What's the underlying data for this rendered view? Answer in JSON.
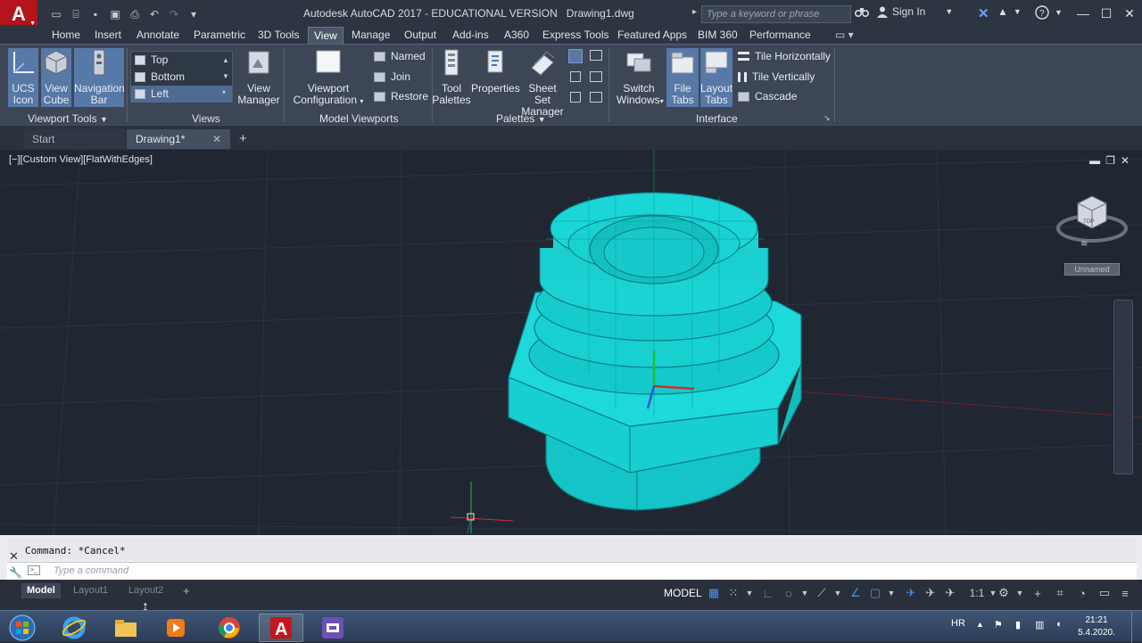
{
  "app": {
    "logo_letter": "A",
    "title": "Autodesk AutoCAD 2017 - EDUCATIONAL VERSION",
    "document": "Drawing1.dwg",
    "search_placeholder": "Type a keyword or phrase",
    "sign_in": "Sign In"
  },
  "ribbon_tabs": [
    "Home",
    "Insert",
    "Annotate",
    "Parametric",
    "3D Tools",
    "View",
    "Manage",
    "Output",
    "Add-ins",
    "A360",
    "Express Tools",
    "Featured Apps",
    "BIM 360",
    "Performance"
  ],
  "active_tab": "View",
  "ribbon": {
    "viewport_tools": {
      "label": "Viewport Tools",
      "ucs_icon": [
        "UCS",
        "Icon"
      ],
      "view_cube": [
        "View",
        "Cube"
      ],
      "navigation_bar": [
        "Navigation",
        "Bar"
      ]
    },
    "views": {
      "label": "Views",
      "items": [
        "Top",
        "Bottom",
        "Left"
      ],
      "selected": "Left",
      "view_manager": [
        "View",
        "Manager"
      ]
    },
    "model_viewports": {
      "label": "Model Viewports",
      "viewport_configuration": [
        "Viewport",
        "Configuration"
      ],
      "named": "Named",
      "join": "Join",
      "restore": "Restore"
    },
    "palettes": {
      "label": "Palettes",
      "tool_palettes": [
        "Tool",
        "Palettes"
      ],
      "properties": "Properties",
      "sheet_set_manager": [
        "Sheet Set",
        "Manager"
      ]
    },
    "interface": {
      "label": "Interface",
      "switch_windows": [
        "Switch",
        "Windows"
      ],
      "file_tabs": [
        "File",
        "Tabs"
      ],
      "layout_tabs": [
        "Layout",
        "Tabs"
      ],
      "tile_horizontally": "Tile Horizontally",
      "tile_vertically": "Tile Vertically",
      "cascade": "Cascade"
    }
  },
  "file_tabs": {
    "start": "Start",
    "drawing": "Drawing1*"
  },
  "viewport": {
    "label": "[−][Custom View][FlatWithEdges]",
    "viewcube_face": "TOP",
    "viewcube_name": "Unnamed"
  },
  "command": {
    "history": "Command: *Cancel*",
    "placeholder": "Type a command"
  },
  "layout_tabs": [
    "Model",
    "Layout1",
    "Layout2"
  ],
  "status": {
    "model": "MODEL",
    "scale": "1:1"
  },
  "tray": {
    "lang": "HR",
    "time": "21:21",
    "date": "5.4.2020."
  },
  "colors": {
    "model_fill": "#15c8c8",
    "model_edge": "#0c7d84",
    "accent_red": "#b3131b"
  }
}
